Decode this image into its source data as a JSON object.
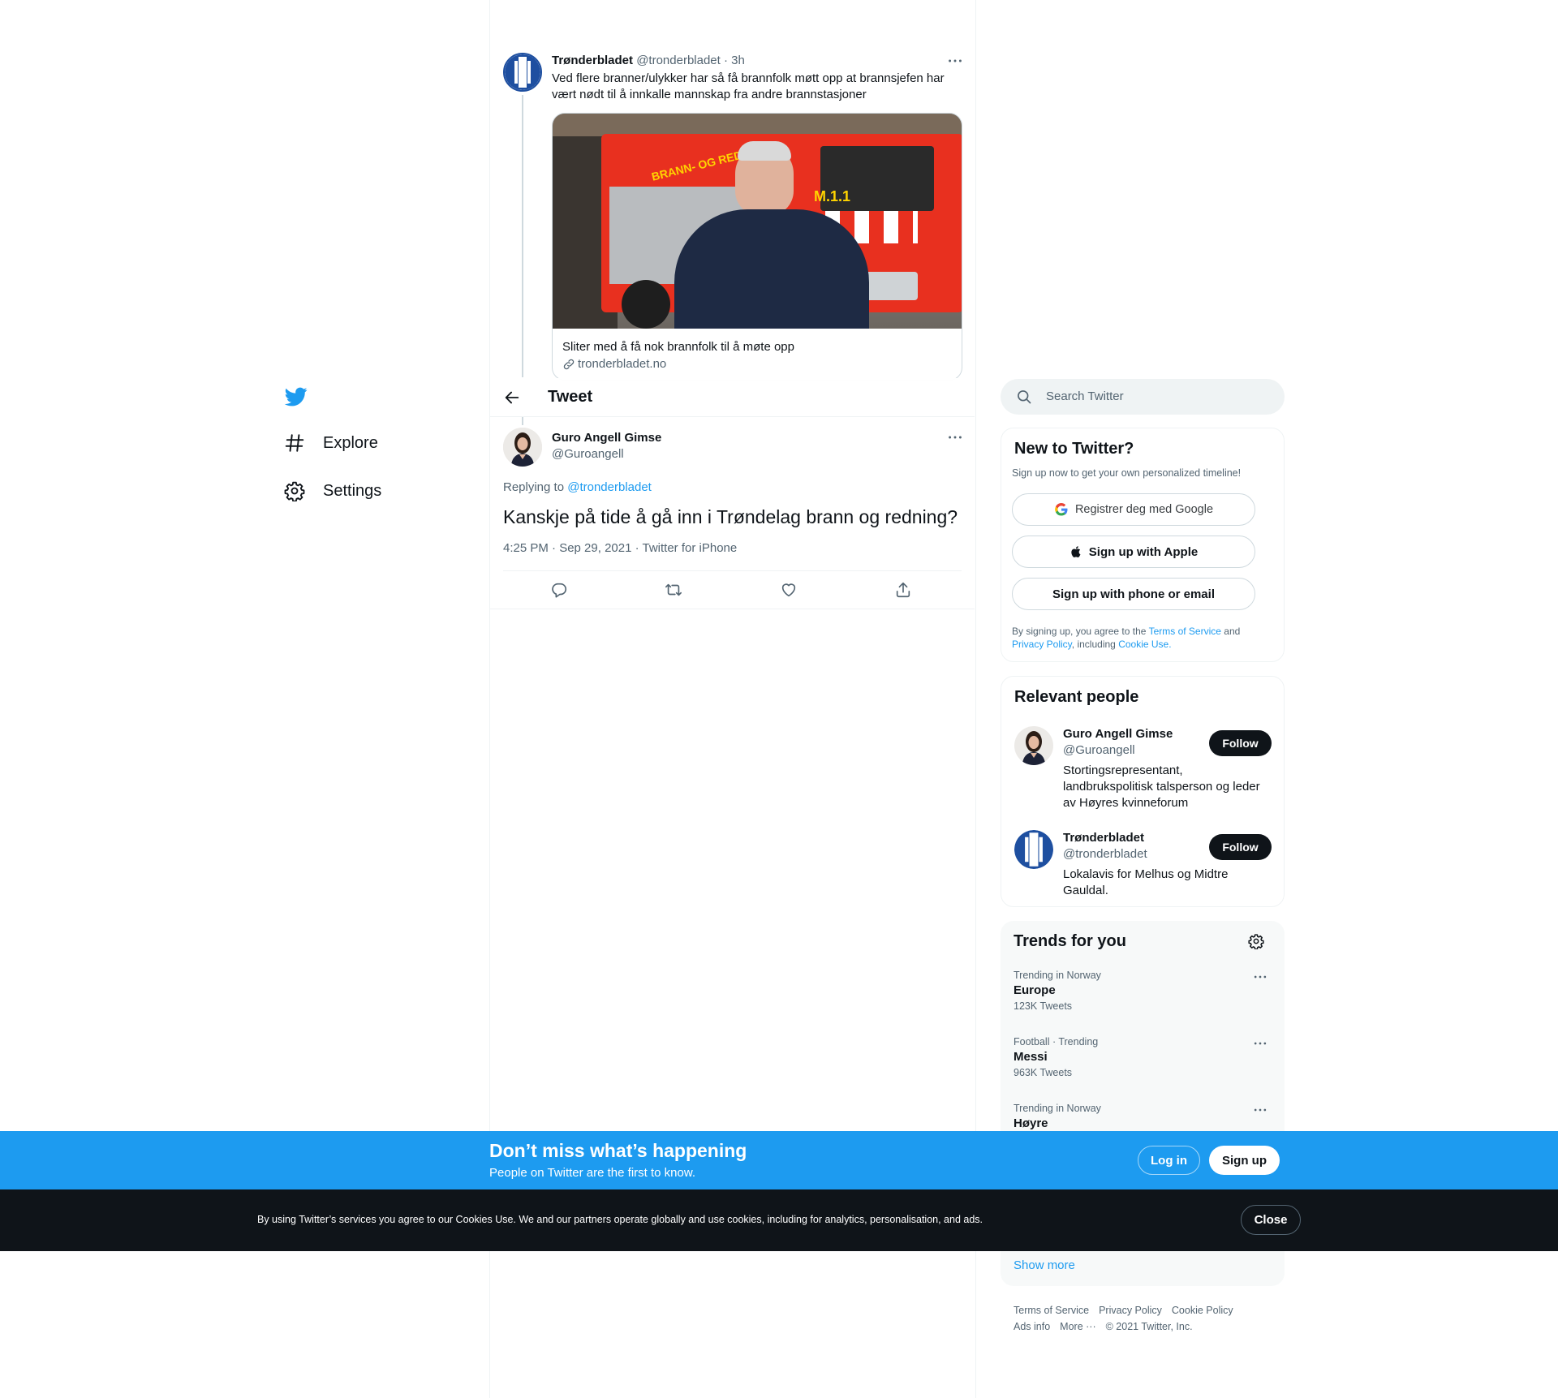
{
  "nav": {
    "explore_label": "Explore",
    "settings_label": "Settings"
  },
  "parent_tweet": {
    "author_name": "Trønderbladet",
    "author_handle": "@tronderbladet",
    "time": "3h",
    "text_line1": "Ved flere branner/ulykker har så få brannfolk møtt opp at brannsjefen har",
    "text_line2": "vært nødt til å innkalle mannskap fra andre brannstasjoner",
    "card_title": "Sliter med å få nok brannfolk til å møte opp",
    "card_domain": "tronderbladet.no",
    "truck_text": "BRANN- OG REDNING",
    "truck_unit": "M.1.1"
  },
  "header": {
    "title": "Tweet"
  },
  "main_tweet": {
    "author_name": "Guro Angell Gimse",
    "author_handle": "@Guroangell",
    "replying_prefix": "Replying to",
    "replying_to": "@tronderbladet",
    "text": "Kanskje på tide å gå inn i Trøndelag brann og redning?",
    "meta": "4:25 PM · Sep 29, 2021 · Twitter for iPhone"
  },
  "search": {
    "placeholder": "Search Twitter"
  },
  "signup_panel": {
    "title": "New to Twitter?",
    "subtitle": "Sign up now to get your own personalized timeline!",
    "google_label": "Registrer deg med Google",
    "apple_label": "Sign up with Apple",
    "phone_label": "Sign up with phone or email",
    "legal_prefix": "By signing up, you agree to the",
    "terms_link": "Terms of Service",
    "legal_and": "and",
    "privacy_link": "Privacy Policy",
    "legal_including": ", including",
    "cookie_link": "Cookie Use."
  },
  "relevant_people": {
    "title": "Relevant people",
    "people": [
      {
        "name": "Guro Angell Gimse",
        "handle": "@Guroangell",
        "follow_label": "Follow",
        "bio_line1": "Stortingsrepresentant,",
        "bio_line2": "landbrukspolitisk talsperson og leder",
        "bio_line3": "av Høyres kvinneforum"
      },
      {
        "name": "Trønderbladet",
        "handle": "@tronderbladet",
        "follow_label": "Follow",
        "bio_line1": "Lokalavis for Melhus og Midtre",
        "bio_line2": "Gauldal."
      }
    ]
  },
  "trends": {
    "title": "Trends for you",
    "items": [
      {
        "context": "Trending in Norway",
        "name": "Europe",
        "count": "123K Tweets"
      },
      {
        "context": "Football · Trending",
        "name": "Messi",
        "count": "963K Tweets"
      },
      {
        "context": "Trending in Norway",
        "name": "Høyre",
        "count": ""
      }
    ],
    "show_more": "Show more"
  },
  "footer": {
    "terms": "Terms of Service",
    "privacy": "Privacy Policy",
    "cookie": "Cookie Policy",
    "ads": "Ads info",
    "more": "More ···",
    "copyright": "© 2021 Twitter, Inc."
  },
  "banner": {
    "headline": "Don’t miss what’s happening",
    "sub": "People on Twitter are the first to know.",
    "login_label": "Log in",
    "signup_label": "Sign up"
  },
  "cookie_bar": {
    "text": "By using Twitter’s services you agree to our Cookies Use. We and our partners operate globally and use cookies, including for analytics, personalisation, and ads.",
    "close_label": "Close"
  },
  "colors": {
    "accent": "#1d9bf0",
    "text": "#0f1419",
    "muted": "#536471",
    "border": "#eff3f4",
    "dark": "#0f1419"
  },
  "icons": {
    "logo": "twitter-bird-icon",
    "explore": "hashtag-icon",
    "settings": "gear-icon",
    "back": "arrow-left-icon",
    "more": "more-dots-icon",
    "link": "link-icon",
    "search": "search-icon",
    "reply": "reply-icon",
    "retweet": "retweet-icon",
    "like": "heart-icon",
    "share": "share-icon",
    "google": "google-icon",
    "apple": "apple-icon"
  }
}
